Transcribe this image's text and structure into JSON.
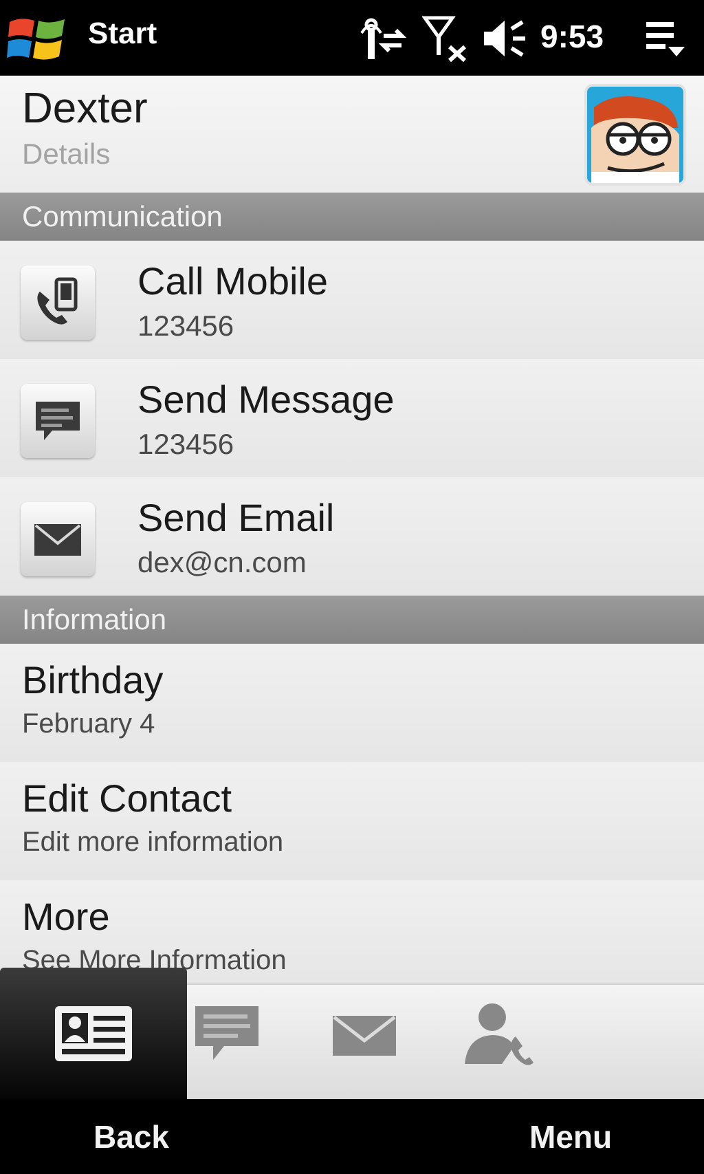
{
  "status_bar": {
    "title": "Start",
    "time": "9:53",
    "icons": [
      "windows-logo",
      "data-connection-icon",
      "signal-off-icon",
      "volume-icon",
      "notification-menu-icon"
    ]
  },
  "contact": {
    "name": "Dexter",
    "subtitle": "Details",
    "avatar": "cartoon-avatar"
  },
  "sections": {
    "communication": "Communication",
    "information": "Information"
  },
  "communication_items": [
    {
      "title": "Call Mobile",
      "value": "123456",
      "icon": "phone-icon"
    },
    {
      "title": "Send Message",
      "value": "123456",
      "icon": "message-icon"
    },
    {
      "title": "Send Email",
      "value": "dex@cn.com",
      "icon": "mail-icon"
    }
  ],
  "information_items": [
    {
      "title": "Birthday",
      "value": "February 4"
    },
    {
      "title": "Edit Contact",
      "value": "Edit more information"
    },
    {
      "title": "More",
      "value": "See More Information"
    }
  ],
  "tabs": [
    {
      "icon": "contact-card-icon",
      "active": true
    },
    {
      "icon": "message-icon",
      "active": false
    },
    {
      "icon": "mail-icon",
      "active": false
    },
    {
      "icon": "call-history-icon",
      "active": false
    }
  ],
  "softkeys": {
    "left": "Back",
    "right": "Menu"
  }
}
